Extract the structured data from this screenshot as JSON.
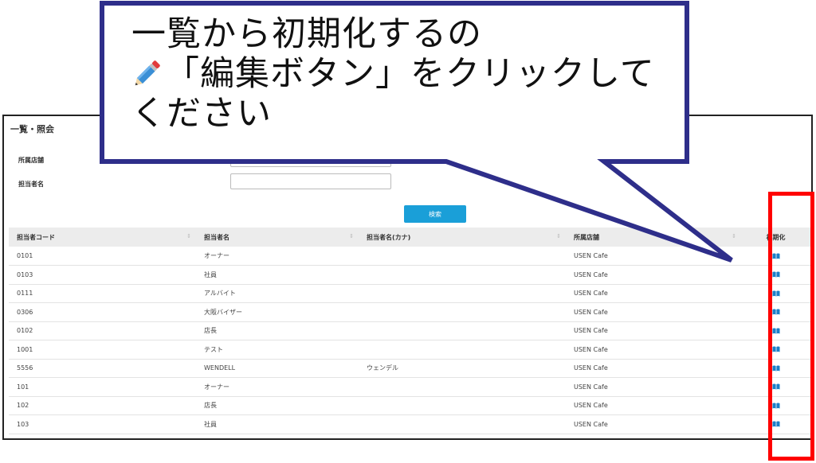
{
  "panel": {
    "title": "一覧・照会",
    "form": {
      "store_label": "所属店舗",
      "store_value": "",
      "staff_label": "担当者名",
      "staff_value": "",
      "search_button": "検索"
    },
    "table": {
      "headers": [
        "担当者コード",
        "担当者名",
        "担当者名(カナ)",
        "所属店舗",
        "初期化"
      ],
      "sort_glyph": "⇕",
      "rows": [
        [
          "0101",
          "オーナー",
          "",
          "USEN Cafe"
        ],
        [
          "0103",
          "社員",
          "",
          "USEN Cafe"
        ],
        [
          "0111",
          "アルバイト",
          "",
          "USEN Cafe"
        ],
        [
          "0306",
          "大阪バイザー",
          "",
          "USEN Cafe"
        ],
        [
          "0102",
          "店長",
          "",
          "USEN Cafe"
        ],
        [
          "1001",
          "テスト",
          "",
          "USEN Cafe"
        ],
        [
          "5556",
          "WENDELL",
          "ウェンデル",
          "USEN Cafe"
        ],
        [
          "101",
          "オーナー",
          "",
          "USEN Cafe"
        ],
        [
          "102",
          "店長",
          "",
          "USEN Cafe"
        ],
        [
          "103",
          "社員",
          "",
          "USEN Cafe"
        ]
      ]
    }
  },
  "callout": {
    "line1": "一覧から初期化するの",
    "line2": "「編集ボタン」をクリックして",
    "line3": "ください",
    "icon": "pencil-icon"
  },
  "colors": {
    "accent": "#1a9fd8",
    "callout_border": "#2e2e8a",
    "highlight": "#ff0000"
  }
}
